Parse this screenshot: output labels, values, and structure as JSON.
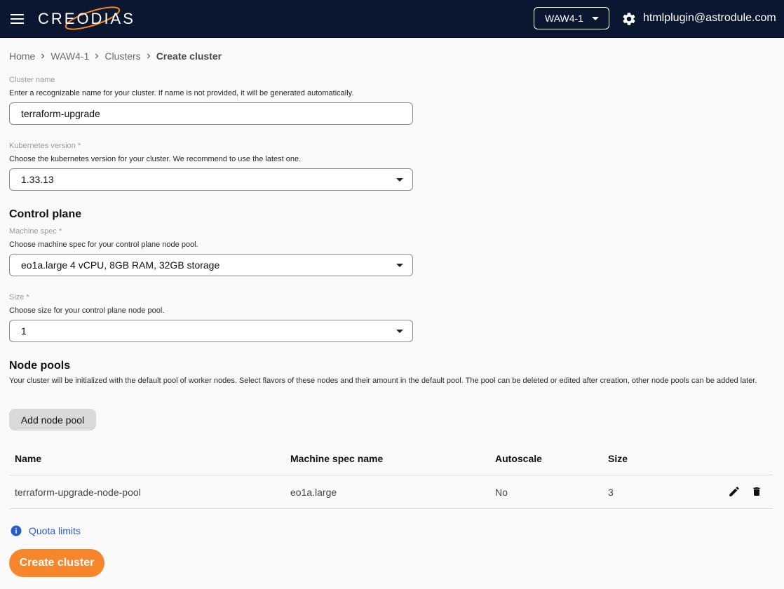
{
  "header": {
    "brand": "CREODIAS",
    "region": "WAW4-1",
    "user_email": "htmlplugin@astrodule.com",
    "background_color": "#0b1730"
  },
  "breadcrumb": {
    "items": [
      "Home",
      "WAW4-1",
      "Clusters"
    ],
    "current": "Create cluster"
  },
  "form": {
    "cluster_name": {
      "label": "Cluster name",
      "help": "Enter a recognizable name for your cluster. If name is not provided, it will be generated automatically.",
      "value": "terraform-upgrade"
    },
    "kubernetes_version": {
      "label": "Kubernetes version *",
      "help": "Choose the kubernetes version for your cluster. We recommend to use the latest one.",
      "value": "1.33.13"
    },
    "control_plane": {
      "title": "Control plane",
      "machine_spec": {
        "label": "Machine spec *",
        "help": "Choose machine spec for your control plane node pool.",
        "value": "eo1a.large 4 vCPU, 8GB RAM, 32GB storage"
      },
      "size": {
        "label": "Size *",
        "help": "Choose size for your control plane node pool.",
        "value": "1"
      }
    },
    "node_pools": {
      "title": "Node pools",
      "description": "Your cluster will be initialized with the default pool of worker nodes. Select flavors of these nodes and their amount in the default pool. The pool can be deleted or edited after creation, other node pools can be added later.",
      "add_button": "Add node pool",
      "columns": [
        "Name",
        "Machine spec name",
        "Autoscale",
        "Size"
      ],
      "rows": [
        {
          "name": "terraform-upgrade-node-pool",
          "machine_spec": "eo1a.large",
          "autoscale": "No",
          "size": "3"
        }
      ]
    }
  },
  "quota_link": "Quota limits",
  "create_button": "Create cluster",
  "colors": {
    "accent": "#f7862b",
    "link": "#2a5cc8"
  }
}
